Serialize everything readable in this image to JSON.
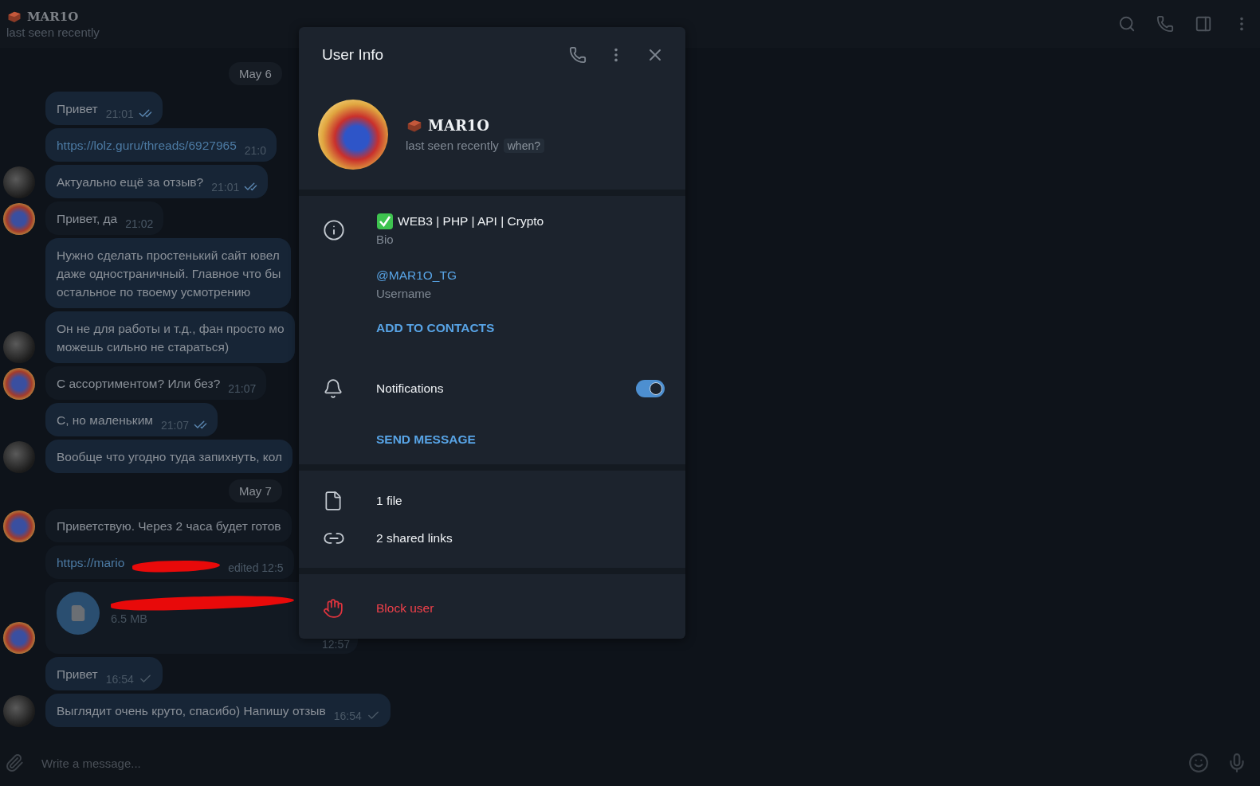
{
  "chat_header": {
    "name": "MAR1O",
    "status": "last seen recently"
  },
  "messages": [
    {
      "kind": "date",
      "text": "May 6"
    },
    {
      "kind": "text",
      "outgoing": true,
      "text": "Привет",
      "time": "21:01",
      "sent": true,
      "read": true
    },
    {
      "kind": "link",
      "outgoing": true,
      "text": "https://lolz.guru/threads/6927965",
      "time": "21:0"
    },
    {
      "kind": "text",
      "outgoing": true,
      "text": "Актуально ещё за отзыв?",
      "time": "21:01",
      "sent": true,
      "read": true,
      "avatar": true
    },
    {
      "kind": "text",
      "outgoing": false,
      "text": "Привет, да",
      "time": "21:02",
      "avatar": true
    },
    {
      "kind": "text",
      "outgoing": true,
      "text": "Нужно сделать простенький сайт ювел\nдаже одностраничный. Главное что бы\nостальное по твоему усмотрению"
    },
    {
      "kind": "text",
      "outgoing": true,
      "text": "Он не для работы и т.д., фан просто мо\nможешь сильно не стараться)",
      "avatar": true
    },
    {
      "kind": "text",
      "outgoing": false,
      "text": "С ассортиментом? Или без?",
      "time": "21:07",
      "avatar": true
    },
    {
      "kind": "text",
      "outgoing": true,
      "text": "С, но маленьким",
      "time": "21:07",
      "sent": true,
      "read": true
    },
    {
      "kind": "text",
      "outgoing": true,
      "text": "Вообще что угодно туда запихнуть, кол",
      "avatar": true
    },
    {
      "kind": "date",
      "text": "May 7"
    },
    {
      "kind": "text",
      "outgoing": false,
      "text": "Приветствую. Через 2 часа будет готов",
      "avatar": true
    },
    {
      "kind": "link",
      "outgoing": false,
      "text": "https://mario",
      "time": "edited 12:5",
      "redacted": true
    },
    {
      "kind": "file",
      "outgoing": false,
      "size": "6.5 MB",
      "time": "12:57",
      "avatar": true,
      "redacted": true
    },
    {
      "kind": "text",
      "outgoing": true,
      "text": "Привет",
      "time": "16:54",
      "sent": true,
      "read": false
    },
    {
      "kind": "text",
      "outgoing": true,
      "text": "Выглядит очень круто, спасибо) Напишу отзыв",
      "time": "16:54",
      "sent": true,
      "read": false,
      "avatar": true
    }
  ],
  "composer": {
    "placeholder": "Write a message..."
  },
  "user_info": {
    "title": "User Info",
    "name": "MAR1O",
    "status": "last seen recently",
    "status_chip": "when?",
    "bio": "WEB3 | PHP | API | Crypto",
    "bio_label": "Bio",
    "username": "@MAR1O_TG",
    "username_label": "Username",
    "add_contact": "ADD TO CONTACTS",
    "notifications": {
      "label": "Notifications",
      "on": true
    },
    "send_message": "SEND MESSAGE",
    "media": [
      {
        "kind": "file",
        "label": "1 file"
      },
      {
        "kind": "link",
        "label": "2 shared links"
      }
    ],
    "block": "Block user"
  }
}
